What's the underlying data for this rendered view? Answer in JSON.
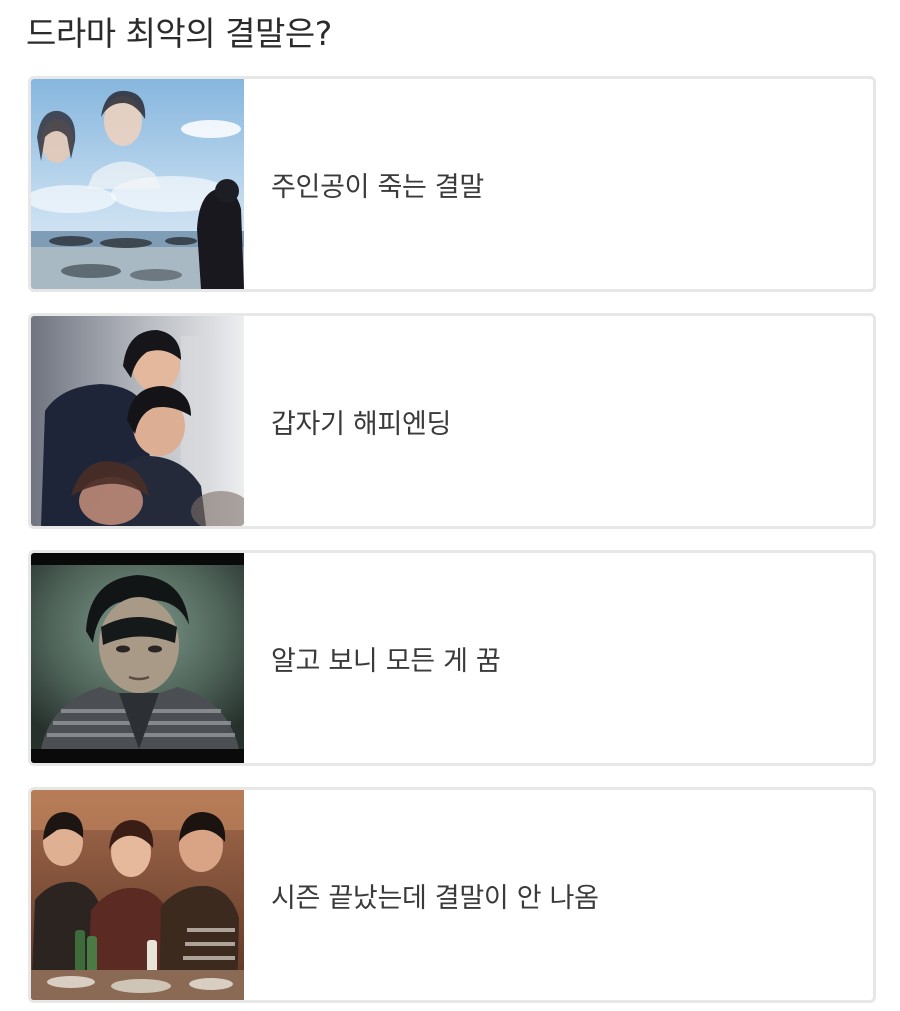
{
  "question": "드라마 최악의 결말은?",
  "options": [
    {
      "label": "주인공이 죽는 결말",
      "thumbnail_icon": "photo-sky-faces-beach"
    },
    {
      "label": "갑자기 해피엔딩",
      "thumbnail_icon": "photo-people-hugging"
    },
    {
      "label": "알고 보니 모든 게 꿈",
      "thumbnail_icon": "photo-man-dark-screen"
    },
    {
      "label": "시즌 끝났는데 결말이 안 나옴",
      "thumbnail_icon": "photo-group-friends"
    }
  ]
}
